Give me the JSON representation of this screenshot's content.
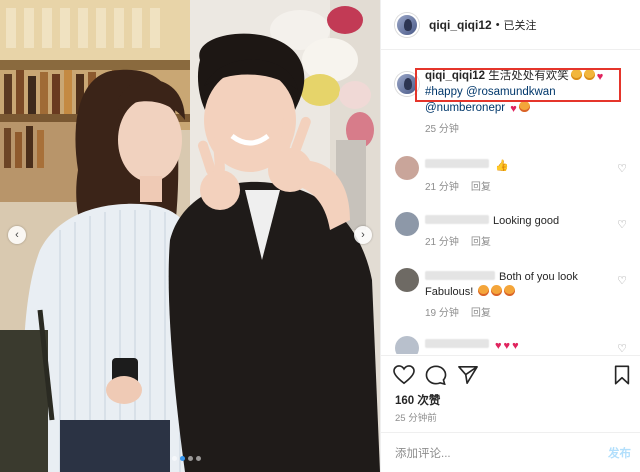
{
  "post": {
    "username": "qiqi_qiqi12",
    "separator": "•",
    "follow_status": "已关注"
  },
  "caption": {
    "username": "qiqi_qiqi12",
    "text": "生活处处有欢笑",
    "line2_tag": "#happy",
    "line2_mention": "@rosamundkwan",
    "line3_mention": "@numberonepr",
    "time": "25 分钟"
  },
  "comments": [
    {
      "text": "",
      "emoji": "thumbs-up",
      "time": "21 分钟",
      "reply": "回复"
    },
    {
      "text": "Looking good",
      "time": "21 分钟",
      "reply": "回复"
    },
    {
      "text": "Both of you look Fabulous!",
      "time": "19 分钟",
      "reply": "回复"
    },
    {
      "text": "",
      "emoji": "hearts",
      "time": "",
      "reply": ""
    }
  ],
  "actions": {
    "likes": "160 次赞",
    "time": "25 分钟前"
  },
  "add_comment": {
    "placeholder": "添加评论...",
    "post_label": "发布"
  },
  "carousel": {
    "dots": 4,
    "active_index": 1
  },
  "colors": {
    "accent": "#3897f0",
    "highlight_box": "#e5352b",
    "link": "#00376b",
    "muted": "#8e8e8e"
  }
}
